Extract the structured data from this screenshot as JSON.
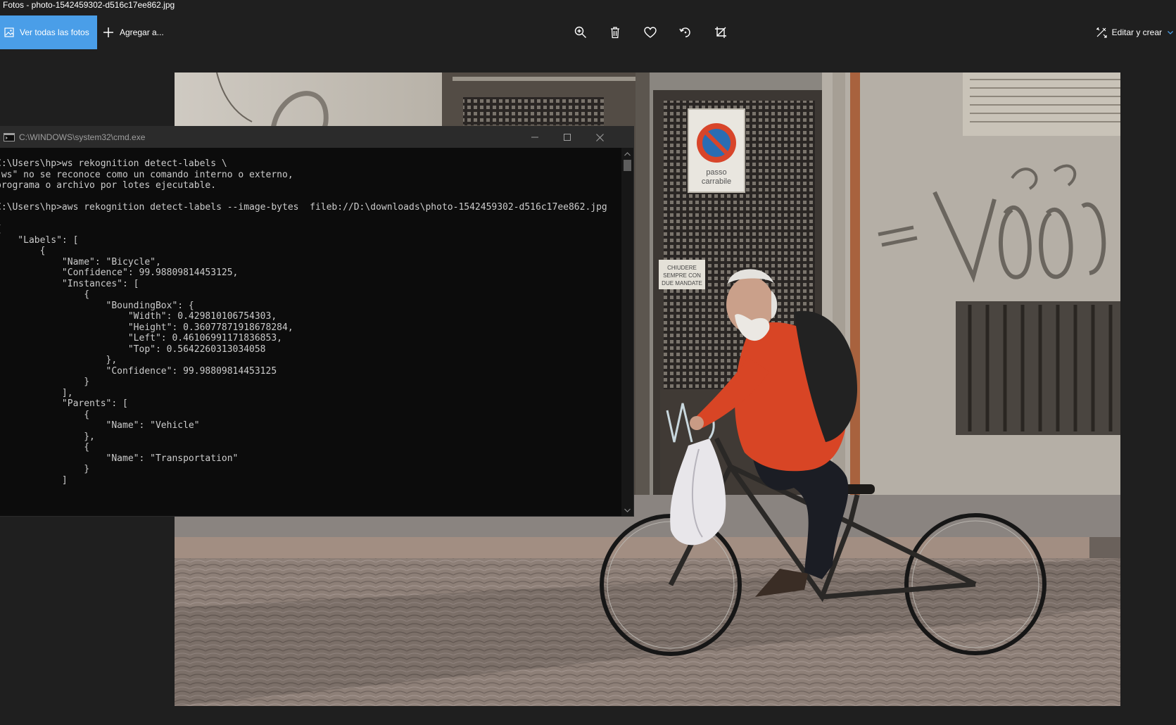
{
  "window": {
    "title": "Fotos - photo-1542459302-d516c17ee862.jpg"
  },
  "toolbar": {
    "all_photos_label": "Ver todas las fotos",
    "add_label": "Agregar a...",
    "edit_label": "Editar y crear",
    "icons": [
      "image-icon",
      "plus-icon",
      "zoom-in-icon",
      "trash-icon",
      "heart-icon",
      "rotate-icon",
      "crop-icon",
      "edit-create-icon",
      "chevron-down-icon"
    ],
    "accent_color": "#4a9ee8"
  },
  "photo": {
    "sign_text_line1": "passo",
    "sign_text_line2": "carrabile",
    "note_line1": "CHIUDERE",
    "note_line2": "SEMPRE CON",
    "note_line3": "DUE MANDATE"
  },
  "cmd": {
    "title": "C:\\WINDOWS\\system32\\cmd.exe",
    "lines": [
      "C:\\Users\\hp>ws rekognition detect-labels \\",
      "\"ws\" no se reconoce como un comando interno o externo,",
      "programa o archivo por lotes ejecutable.",
      "",
      "C:\\Users\\hp>aws rekognition detect-labels --image-bytes  fileb://D:\\downloads\\photo-1542459302-d516c17ee862.jpg",
      "",
      "{",
      "    \"Labels\": [",
      "        {",
      "            \"Name\": \"Bicycle\",",
      "            \"Confidence\": 99.98809814453125,",
      "            \"Instances\": [",
      "                {",
      "                    \"BoundingBox\": {",
      "                        \"Width\": 0.429810106754303,",
      "                        \"Height\": 0.36077871918678284,",
      "                        \"Left\": 0.46106991171836853,",
      "                        \"Top\": 0.5642260313034058",
      "                    },",
      "                    \"Confidence\": 99.98809814453125",
      "                }",
      "            ],",
      "            \"Parents\": [",
      "                {",
      "                    \"Name\": \"Vehicle\"",
      "                },",
      "                {",
      "                    \"Name\": \"Transportation\"",
      "                }",
      "            ]",
      "        },"
    ]
  }
}
